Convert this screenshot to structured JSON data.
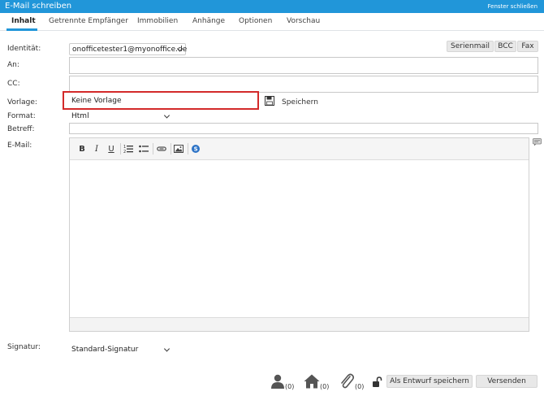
{
  "window": {
    "title": "E-Mail schreiben",
    "close_label": "Fenster schließen"
  },
  "tabs": [
    {
      "label": "Inhalt",
      "active": true
    },
    {
      "label": "Getrennte Empfänger"
    },
    {
      "label": "Immobilien"
    },
    {
      "label": "Anhänge"
    },
    {
      "label": "Optionen"
    },
    {
      "label": "Vorschau"
    }
  ],
  "form": {
    "identitaet_label": "Identität:",
    "identitaet_value": "onofficetester1@myonoffice.de",
    "an_label": "An:",
    "cc_label": "CC:",
    "vorlage_label": "Vorlage:",
    "vorlage_value": "Keine Vorlage",
    "speichern_label": "Speichern",
    "format_label": "Format:",
    "format_value": "Html",
    "betreff_label": "Betreff:",
    "email_label": "E-Mail:",
    "signatur_label": "Signatur:",
    "signatur_value": "Standard-Signatur"
  },
  "top_buttons": {
    "serienmail": "Serienmail",
    "bcc": "BCC",
    "fax": "Fax"
  },
  "footer": {
    "contacts_count": "(0)",
    "properties_count": "(0)",
    "attachments_count": "(0)",
    "draft_button": "Als Entwurf speichern",
    "send_button": "Versenden"
  },
  "colors": {
    "accent": "#2196d9",
    "highlight": "#d32a2a"
  }
}
